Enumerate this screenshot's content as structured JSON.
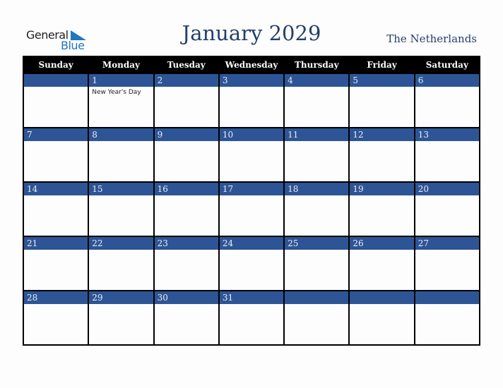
{
  "logo": {
    "line1": "General",
    "line2": "Blue"
  },
  "title": "January 2029",
  "country": "The Netherlands",
  "weekdays": [
    "Sunday",
    "Monday",
    "Tuesday",
    "Wednesday",
    "Thursday",
    "Friday",
    "Saturday"
  ],
  "weeks": [
    [
      {
        "d": ""
      },
      {
        "d": "1",
        "holiday": "New Year's Day"
      },
      {
        "d": "2"
      },
      {
        "d": "3"
      },
      {
        "d": "4"
      },
      {
        "d": "5"
      },
      {
        "d": "6"
      }
    ],
    [
      {
        "d": "7"
      },
      {
        "d": "8"
      },
      {
        "d": "9"
      },
      {
        "d": "10"
      },
      {
        "d": "11"
      },
      {
        "d": "12"
      },
      {
        "d": "13"
      }
    ],
    [
      {
        "d": "14"
      },
      {
        "d": "15"
      },
      {
        "d": "16"
      },
      {
        "d": "17"
      },
      {
        "d": "18"
      },
      {
        "d": "19"
      },
      {
        "d": "20"
      }
    ],
    [
      {
        "d": "21"
      },
      {
        "d": "22"
      },
      {
        "d": "23"
      },
      {
        "d": "24"
      },
      {
        "d": "25"
      },
      {
        "d": "26"
      },
      {
        "d": "27"
      }
    ],
    [
      {
        "d": "28"
      },
      {
        "d": "29"
      },
      {
        "d": "30"
      },
      {
        "d": "31"
      },
      {
        "d": ""
      },
      {
        "d": ""
      },
      {
        "d": ""
      }
    ]
  ],
  "colors": {
    "accent": "#2d5596",
    "header": "#000000",
    "title": "#243f6b"
  }
}
